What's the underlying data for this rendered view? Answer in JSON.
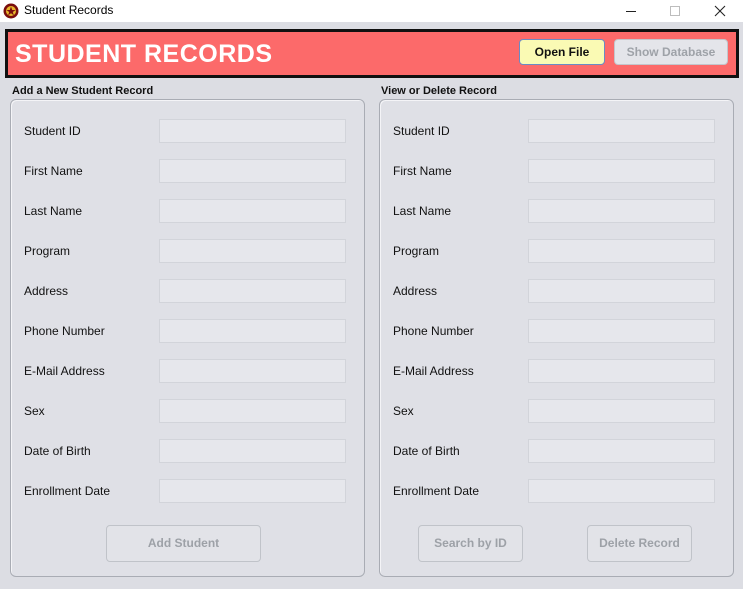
{
  "window": {
    "title": "Student Records",
    "icon": "app-logo-icon"
  },
  "header": {
    "title": "STUDENT RECORDS",
    "open_file_label": "Open File",
    "show_database_label": "Show Database"
  },
  "add_panel": {
    "title": "Add a New Student Record",
    "fields": [
      {
        "label": "Student ID",
        "value": ""
      },
      {
        "label": "First Name",
        "value": ""
      },
      {
        "label": "Last Name",
        "value": ""
      },
      {
        "label": "Program",
        "value": ""
      },
      {
        "label": "Address",
        "value": ""
      },
      {
        "label": "Phone Number",
        "value": ""
      },
      {
        "label": "E-Mail Address",
        "value": ""
      },
      {
        "label": "Sex",
        "value": ""
      },
      {
        "label": "Date of Birth",
        "value": ""
      },
      {
        "label": "Enrollment Date",
        "value": ""
      }
    ],
    "add_button_label": "Add Student"
  },
  "view_panel": {
    "title": "View or Delete Record",
    "fields": [
      {
        "label": "Student ID",
        "value": ""
      },
      {
        "label": "First Name",
        "value": ""
      },
      {
        "label": "Last Name",
        "value": ""
      },
      {
        "label": "Program",
        "value": ""
      },
      {
        "label": "Address",
        "value": ""
      },
      {
        "label": "Phone Number",
        "value": ""
      },
      {
        "label": "E-Mail Address",
        "value": ""
      },
      {
        "label": "Sex",
        "value": ""
      },
      {
        "label": "Date of Birth",
        "value": ""
      },
      {
        "label": "Enrollment Date",
        "value": ""
      }
    ],
    "search_button_label": "Search by ID",
    "delete_button_label": "Delete Record"
  },
  "colors": {
    "banner": "#fc6a6a",
    "open_file_button": "#fafab4",
    "disabled_text": "#9ea2a8"
  }
}
